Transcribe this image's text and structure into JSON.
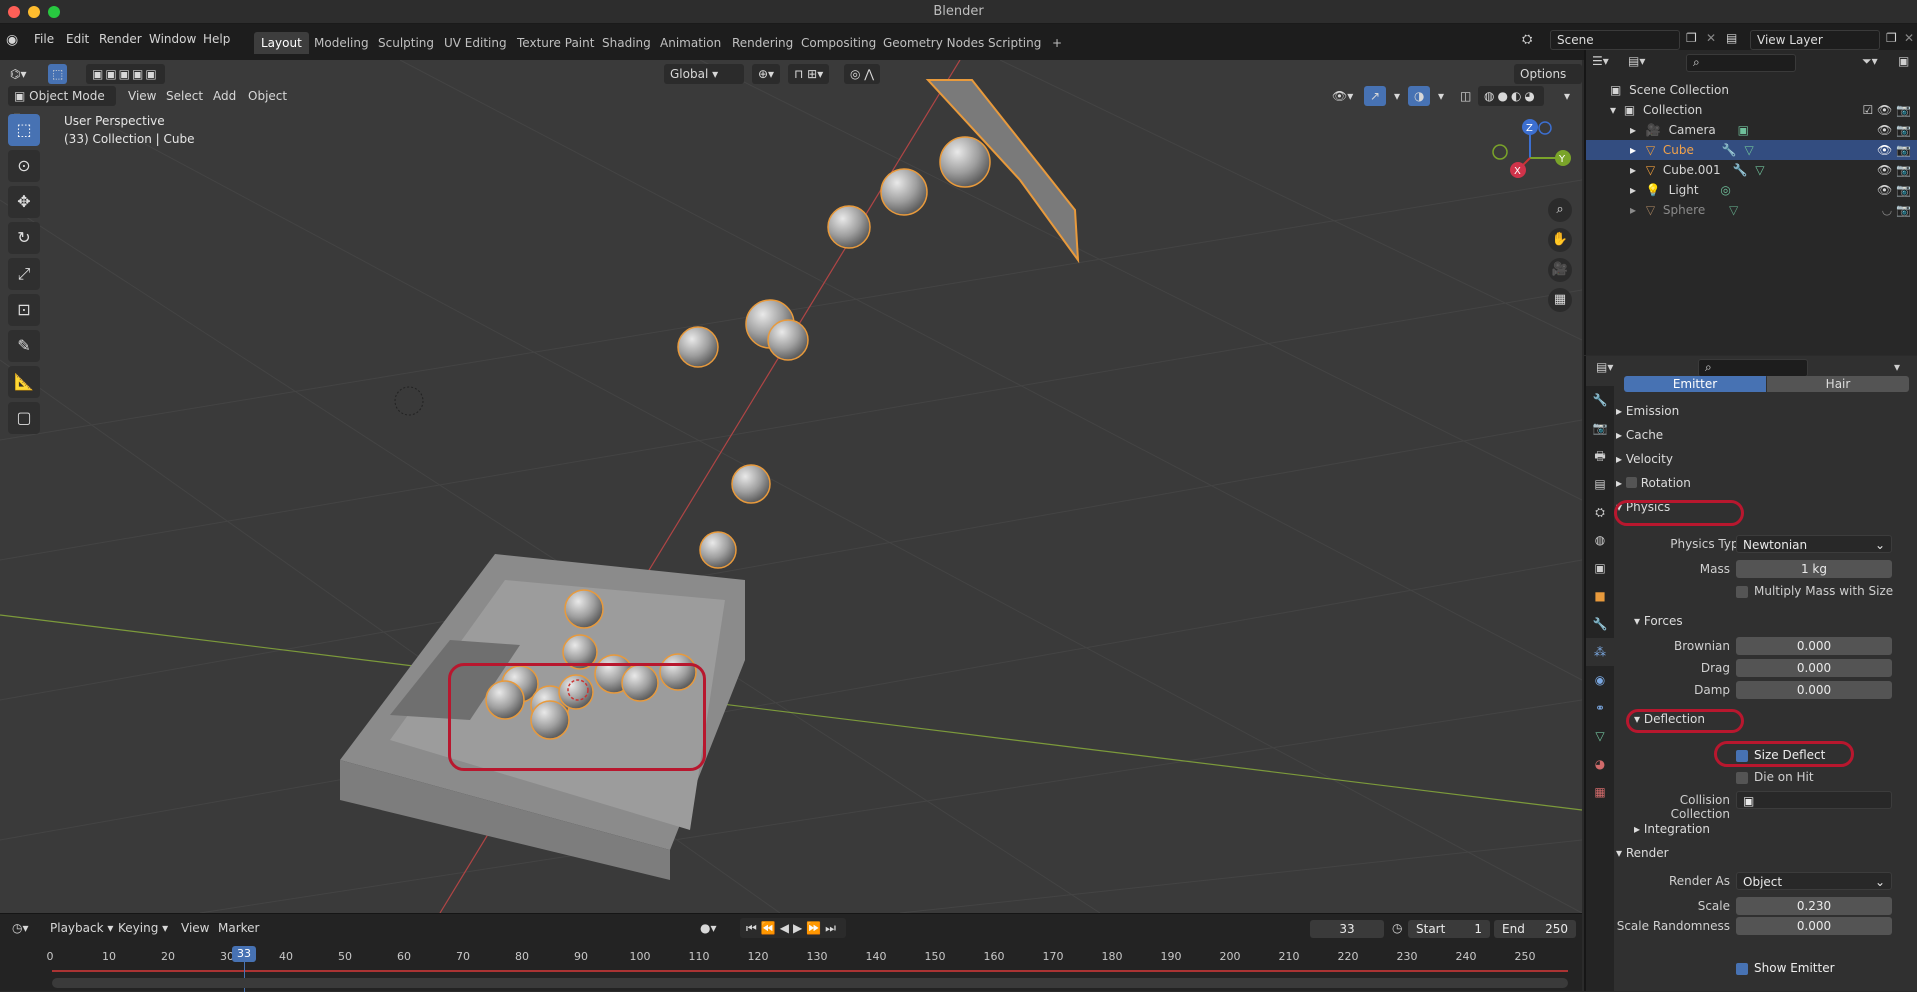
{
  "app": {
    "title": "Blender"
  },
  "menu": [
    "File",
    "Edit",
    "Render",
    "Window",
    "Help"
  ],
  "workspaces": [
    "Layout",
    "Modeling",
    "Sculpting",
    "UV Editing",
    "Texture Paint",
    "Shading",
    "Animation",
    "Rendering",
    "Compositing",
    "Geometry Nodes",
    "Scripting"
  ],
  "scene": {
    "name": "Scene",
    "view_layer": "View Layer"
  },
  "viewport": {
    "mode": "Object Mode",
    "menus": [
      "View",
      "Select",
      "Add",
      "Object"
    ],
    "transform": "Global",
    "options": "Options",
    "info_line1": "User Perspective",
    "info_line2": "(33) Collection | Cube"
  },
  "outliner": {
    "root": "Scene Collection",
    "collection": "Collection",
    "items": [
      "Camera",
      "Cube",
      "Cube.001",
      "Light",
      "Sphere"
    ]
  },
  "props": {
    "tabs": [
      "Emitter",
      "Hair"
    ],
    "sections": {
      "emission": "Emission",
      "cache": "Cache",
      "velocity": "Velocity",
      "rotation": "Rotation",
      "physics": "Physics",
      "forces": "Forces",
      "deflection": "Deflection",
      "integration": "Integration",
      "render": "Render"
    },
    "physics_type_label": "Physics Type",
    "physics_type": "Newtonian",
    "mass_label": "Mass",
    "mass": "1 kg",
    "multiply_mass": "Multiply Mass with Size",
    "brownian_label": "Brownian",
    "brownian": "0.000",
    "drag_label": "Drag",
    "drag": "0.000",
    "damp_label": "Damp",
    "damp": "0.000",
    "size_deflect": "Size Deflect",
    "die_on_hit": "Die on Hit",
    "collision_collection": "Collision Collection",
    "render_as_label": "Render As",
    "render_as": "Object",
    "scale_label": "Scale",
    "scale": "0.230",
    "scale_rand_label": "Scale Randomness",
    "scale_rand": "0.000",
    "show_emitter": "Show Emitter"
  },
  "timeline": {
    "menus": [
      "Playback",
      "Keying",
      "View",
      "Marker"
    ],
    "current_frame": "33",
    "start_label": "Start",
    "start": "1",
    "end_label": "End",
    "end": "250",
    "ticks": [
      "0",
      "10",
      "20",
      "30",
      "40",
      "50",
      "60",
      "70",
      "80",
      "90",
      "100",
      "110",
      "120",
      "130",
      "140",
      "150",
      "160",
      "170",
      "180",
      "190",
      "200",
      "210",
      "220",
      "230",
      "240",
      "250"
    ]
  },
  "colors": {
    "accent": "#4772b3",
    "highlight": "#b8172e",
    "selected": "#e89a3c"
  }
}
